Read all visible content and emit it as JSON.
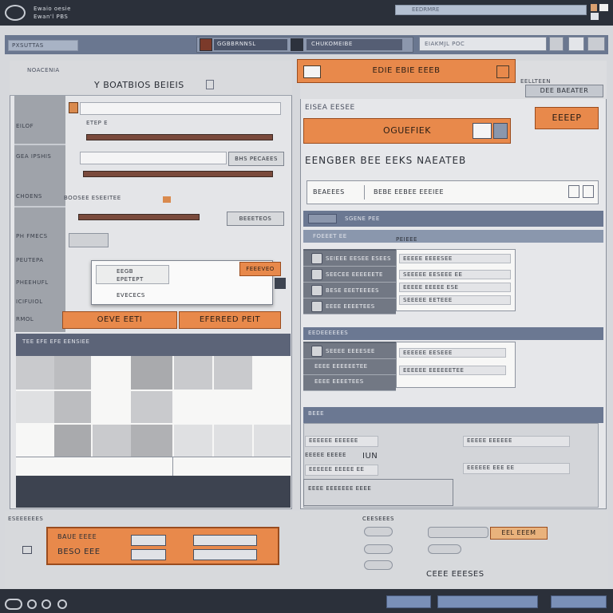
{
  "titlebar": {
    "app_title_1": "Ewaio oesie",
    "app_title_2": "Ewan'l PBS",
    "search_placeholder": "EEDRMRE"
  },
  "toolbar": {
    "menu_label": "PXSUTTAS",
    "field_1": "GGBBRNNSL",
    "field_2": "CHUKOMEIBE",
    "search_text": "EIAKMJL POC"
  },
  "left_panel": {
    "header_sub": "NOACENIA",
    "header_title": "Y BOATBIOS BEIEIS",
    "side_labels": [
      "EILOF",
      "GEA IPSHIS",
      "CHOENS",
      "PH FMECS",
      "PEUTEPA",
      "PHEEHUFL",
      "ICIFUIOL",
      "RMOL"
    ],
    "row1_label": "ETEP E",
    "row2_button": "BHS PECAEES",
    "row3_label": "BOOSEE ESEEITEE",
    "row3_button": "BEEETEOS",
    "popup_lines": [
      "EEGB",
      "EPETEPT",
      "EVECECS"
    ],
    "popup_button": "FEEEVEO",
    "orange_left": "OEVE EETI",
    "orange_right": "EFEREED PEIT",
    "grid_header": "TEE EFE EFE EENSIEE"
  },
  "right_panel": {
    "orange_1": "EDIE EBIE EEEB",
    "side_label": "EELLTEEN",
    "side_box": "DEE BAEATER",
    "sub_label": "EISEA EESEE",
    "orange_2": "OGUEFIEK",
    "orange_3": "EEEEP",
    "big_label": "EENGBER BEE EEKS NAEATEB",
    "input_prefix": "BEAEEES",
    "input_text": "BEBE EEBEE EEEIEE",
    "section_1": "SGENE PEE",
    "section_1b": "FOEEET EE",
    "section_1c": "PEIEEE",
    "list_rows": [
      {
        "label": "SEIEEE EESEE ESEES"
      },
      {
        "label": "SEECEE EEEEEETE"
      },
      {
        "label": "BESE EEETEEEES"
      },
      {
        "label": "EEEE EEEETEES"
      }
    ],
    "detail_lines": [
      "EEEEE EEEESEE",
      "SEEEEE EESEEE EE",
      "EEEEE EEEEE ESE",
      "SEEEEE EETEEE"
    ],
    "section_2": "EEDEEEEEES",
    "list_rows_2": [
      {
        "label": "SEEEE EEEESEE"
      },
      {
        "label": "EEEE EEEEEETEE"
      },
      {
        "label": "EEEE EEEETEES"
      }
    ],
    "detail_lines_2": [
      "EEEEEE EESEEE",
      "EEEEEE EEEEEETEE"
    ],
    "section_3": "BEEE",
    "form_labels": [
      "EEEEEE EEEEEE",
      "EEEEE EEEEE",
      "EEEEEE EEEEE EE",
      "EEEE EEEEEEE EEEE"
    ],
    "form_mid": "IUN",
    "form_right": [
      "EEEEE EEEEEE",
      "EEEEEE EEE EE"
    ]
  },
  "bottom": {
    "label": "ESEEEEEES",
    "orange_top_left": "BAUE EEEE",
    "orange_bottom_left": "BESO EEE",
    "right_label": "CEESEEES",
    "right_button": "EEL EEEM",
    "bottom_label": "CEEE EEESES"
  }
}
